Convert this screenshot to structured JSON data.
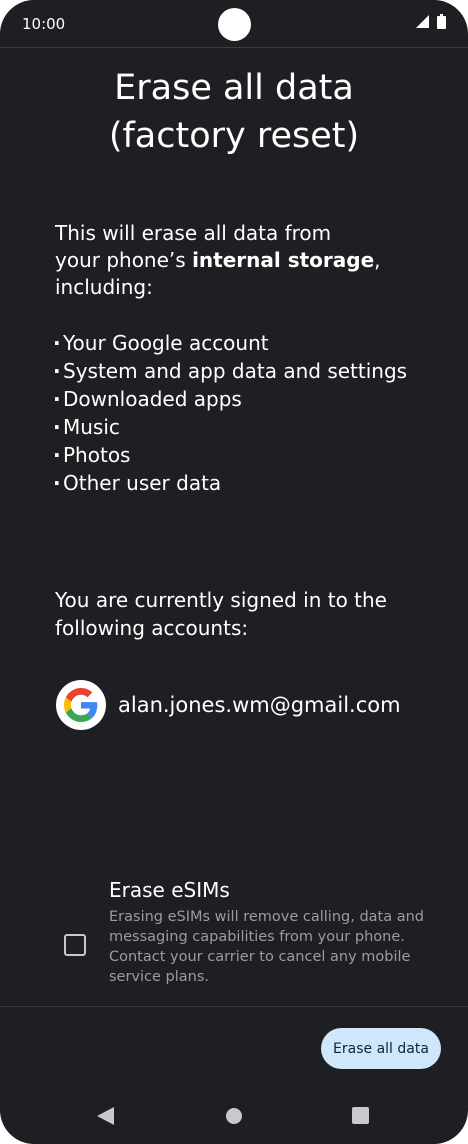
{
  "status_bar": {
    "time": "10:00"
  },
  "title_line1": "Erase all data",
  "title_line2": "(factory reset)",
  "intro": {
    "prefix_line1": "This will erase all data from",
    "prefix_line2": "your phone’s",
    "bold": "internal storage",
    "suffix": ",",
    "line3": "including:"
  },
  "items": [
    "Your Google account",
    "System and app data and settings",
    "Downloaded apps",
    "Music",
    "Photos",
    "Other user data"
  ],
  "signed_in_text": "You are currently signed in to the following accounts:",
  "account": {
    "email": "alan.jones.wm@gmail.com",
    "icon": "google-logo"
  },
  "esim": {
    "title": "Erase eSIMs",
    "description": "Erasing eSIMs will remove calling, data and messaging capabilities from your phone. Contact your carrier to cancel any mobile service plans.",
    "checked": false
  },
  "erase_button_label": "Erase all data",
  "colors": {
    "background": "#1e1f22",
    "button": "#cfe6fb",
    "button_text": "#0c2540"
  }
}
